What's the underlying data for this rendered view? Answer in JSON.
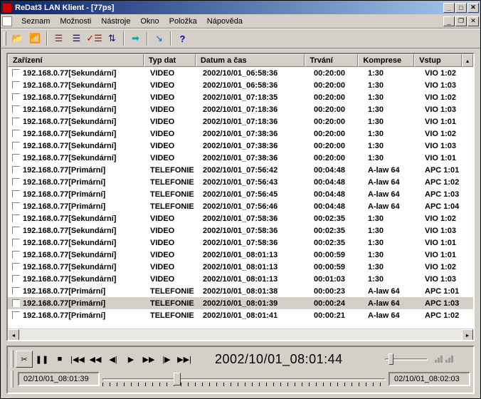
{
  "window": {
    "title": "ReDat3 LAN Klient - [77ps]"
  },
  "menu": {
    "items": [
      "Seznam",
      "Možnosti",
      "Nástroje",
      "Okno",
      "Položka",
      "Nápověda"
    ]
  },
  "toolbar": {
    "icons": [
      "open-icon",
      "connect-icon",
      "list-red-icon",
      "list-blue-icon",
      "list-check-icon",
      "list-sort-icon",
      "arrow-right-icon",
      "key-icon",
      "help-icon"
    ]
  },
  "table": {
    "columns": [
      "Zařízení",
      "Typ dat",
      "Datum a čas",
      "Trvání",
      "Komprese",
      "Vstup"
    ],
    "rows": [
      {
        "dev": "192.168.0.77[Sekundární]",
        "typ": "VIDEO",
        "dt": "2002/10/01_06:58:36",
        "trv": "00:20:00",
        "kom": "1:30",
        "vst": "VIO 1:02"
      },
      {
        "dev": "192.168.0.77[Sekundární]",
        "typ": "VIDEO",
        "dt": "2002/10/01_06:58:36",
        "trv": "00:20:00",
        "kom": "1:30",
        "vst": "VIO 1:03"
      },
      {
        "dev": "192.168.0.77[Sekundární]",
        "typ": "VIDEO",
        "dt": "2002/10/01_07:18:35",
        "trv": "00:20:00",
        "kom": "1:30",
        "vst": "VIO 1:02"
      },
      {
        "dev": "192.168.0.77[Sekundární]",
        "typ": "VIDEO",
        "dt": "2002/10/01_07:18:36",
        "trv": "00:20:00",
        "kom": "1:30",
        "vst": "VIO 1:03"
      },
      {
        "dev": "192.168.0.77[Sekundární]",
        "typ": "VIDEO",
        "dt": "2002/10/01_07:18:36",
        "trv": "00:20:00",
        "kom": "1:30",
        "vst": "VIO 1:01"
      },
      {
        "dev": "192.168.0.77[Sekundární]",
        "typ": "VIDEO",
        "dt": "2002/10/01_07:38:36",
        "trv": "00:20:00",
        "kom": "1:30",
        "vst": "VIO 1:02"
      },
      {
        "dev": "192.168.0.77[Sekundární]",
        "typ": "VIDEO",
        "dt": "2002/10/01_07:38:36",
        "trv": "00:20:00",
        "kom": "1:30",
        "vst": "VIO 1:03"
      },
      {
        "dev": "192.168.0.77[Sekundární]",
        "typ": "VIDEO",
        "dt": "2002/10/01_07:38:36",
        "trv": "00:20:00",
        "kom": "1:30",
        "vst": "VIO 1:01"
      },
      {
        "dev": "192.168.0.77[Primární]",
        "typ": "TELEFONIE",
        "dt": "2002/10/01_07:56:42",
        "trv": "00:04:48",
        "kom": "A-law 64",
        "vst": "APC 1:01"
      },
      {
        "dev": "192.168.0.77[Primární]",
        "typ": "TELEFONIE",
        "dt": "2002/10/01_07:56:43",
        "trv": "00:04:48",
        "kom": "A-law 64",
        "vst": "APC 1:02"
      },
      {
        "dev": "192.168.0.77[Primární]",
        "typ": "TELEFONIE",
        "dt": "2002/10/01_07:56:45",
        "trv": "00:04:48",
        "kom": "A-law 64",
        "vst": "APC 1:03"
      },
      {
        "dev": "192.168.0.77[Primární]",
        "typ": "TELEFONIE",
        "dt": "2002/10/01_07:56:46",
        "trv": "00:04:48",
        "kom": "A-law 64",
        "vst": "APC 1:04"
      },
      {
        "dev": "192.168.0.77[Sekundární]",
        "typ": "VIDEO",
        "dt": "2002/10/01_07:58:36",
        "trv": "00:02:35",
        "kom": "1:30",
        "vst": "VIO 1:02"
      },
      {
        "dev": "192.168.0.77[Sekundární]",
        "typ": "VIDEO",
        "dt": "2002/10/01_07:58:36",
        "trv": "00:02:35",
        "kom": "1:30",
        "vst": "VIO 1:03"
      },
      {
        "dev": "192.168.0.77[Sekundární]",
        "typ": "VIDEO",
        "dt": "2002/10/01_07:58:36",
        "trv": "00:02:35",
        "kom": "1:30",
        "vst": "VIO 1:01"
      },
      {
        "dev": "192.168.0.77[Sekundární]",
        "typ": "VIDEO",
        "dt": "2002/10/01_08:01:13",
        "trv": "00:00:59",
        "kom": "1:30",
        "vst": "VIO 1:01"
      },
      {
        "dev": "192.168.0.77[Sekundární]",
        "typ": "VIDEO",
        "dt": "2002/10/01_08:01:13",
        "trv": "00:00:59",
        "kom": "1:30",
        "vst": "VIO 1:02"
      },
      {
        "dev": "192.168.0.77[Sekundární]",
        "typ": "VIDEO",
        "dt": "2002/10/01_08:01:13",
        "trv": "00:01:03",
        "kom": "1:30",
        "vst": "VIO 1:03"
      },
      {
        "dev": "192.168.0.77[Primární]",
        "typ": "TELEFONIE",
        "dt": "2002/10/01_08:01:38",
        "trv": "00:00:23",
        "kom": "A-law 64",
        "vst": "APC 1:01"
      },
      {
        "dev": "192.168.0.77[Primární]",
        "typ": "TELEFONIE",
        "dt": "2002/10/01_08:01:39",
        "trv": "00:00:24",
        "kom": "A-law 64",
        "vst": "APC 1:03",
        "selected": true
      },
      {
        "dev": "192.168.0.77[Primární]",
        "typ": "TELEFONIE",
        "dt": "2002/10/01_08:01:41",
        "trv": "00:00:21",
        "kom": "A-law 64",
        "vst": "APC 1:02"
      }
    ]
  },
  "player": {
    "current_time": "2002/10/01_08:01:44",
    "seek_start": "02/10/01_08:01:39",
    "seek_end": "02/10/01_08:02:03"
  }
}
